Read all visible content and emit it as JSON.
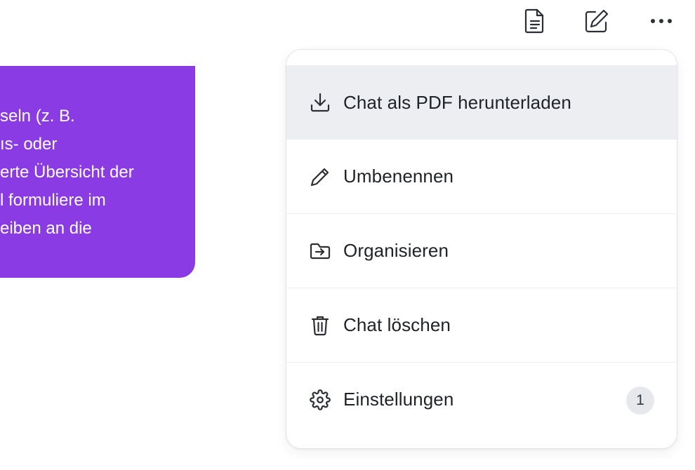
{
  "toolbar": {
    "icons": [
      "document-icon",
      "edit-icon",
      "more-icon"
    ]
  },
  "message": {
    "lines": [
      "seln (z. B.",
      "ıs- oder",
      "erte Übersicht der",
      "l formuliere im",
      "eiben an die"
    ],
    "bubble_color": "#8a3be3"
  },
  "menu": {
    "items": [
      {
        "label": "Chat als PDF herunterladen",
        "icon": "download-icon"
      },
      {
        "label": "Umbenennen",
        "icon": "pencil-icon"
      },
      {
        "label": "Organisieren",
        "icon": "folder-move-icon"
      },
      {
        "label": "Chat löschen",
        "icon": "trash-icon"
      },
      {
        "label": "Einstellungen",
        "icon": "gear-icon",
        "badge": "1"
      }
    ],
    "highlight_color": "#eceef2"
  }
}
